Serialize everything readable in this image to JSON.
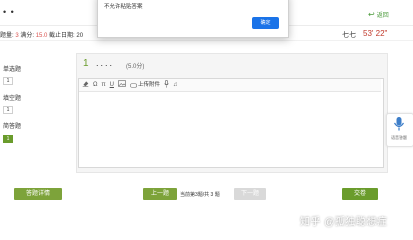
{
  "header": {
    "title": "• •",
    "back_label": "返回",
    "back_icon": "back-arrow-icon"
  },
  "info": {
    "prefix": "题量: ",
    "count": "3",
    "score_label": " 满分: ",
    "score": "15.0",
    "deadline_label": " 截止日期: ",
    "deadline": "20"
  },
  "week_label": "七七",
  "timer": "53' 22\"",
  "sidebar": {
    "sections": [
      {
        "label": "单选题",
        "numbers": [
          "1"
        ]
      },
      {
        "label": "填空题",
        "numbers": [
          "1"
        ]
      },
      {
        "label": "简答题",
        "numbers": [
          "1"
        ]
      }
    ]
  },
  "question": {
    "number": "1",
    "dots": "....",
    "score": "(5.0分)"
  },
  "toolbar": {
    "upload_label": "上传附件",
    "tools": [
      "eraser-icon",
      "omega-icon",
      "pi-icon",
      "underline-icon",
      "image-icon",
      "upload-icon",
      "microphone-icon",
      "music-note-icon"
    ]
  },
  "footer": {
    "detail_button": "答题详情",
    "prev_button": "上一题",
    "progress": "当前第3题/共 3 题",
    "next_button": "下一题",
    "submit_button": "交卷"
  },
  "voice": {
    "label": "语音答题",
    "icon": "microphone-icon"
  },
  "watermark": "知乎 @孤独聪想症",
  "dialog": {
    "message": "不允许粘贴答案",
    "ok_button": "确定"
  },
  "colors": {
    "accent_green": "#6a9c2c",
    "button_green": "#7da33a",
    "timer_red": "#c0392b",
    "dialog_blue": "#1a73e8",
    "disabled_gray": "#d9d9d9"
  }
}
